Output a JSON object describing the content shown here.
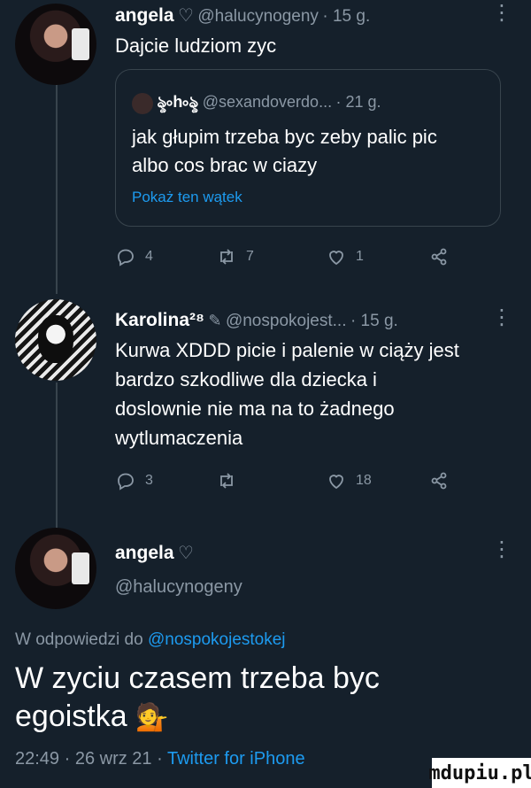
{
  "tweet1": {
    "name": "angela",
    "handle": "@halucynogeny",
    "time": "· 15 g.",
    "text": "Dajcie ludziom zyc",
    "quote": {
      "name": "ৡ৹h৹ৡ",
      "handle": "@sexandoverdo...",
      "time": "· 21 g.",
      "text_line1": "jak głupim trzeba byc zeby palic pic",
      "text_line2": "albo cos brac w ciazy",
      "show_thread": "Pokaż ten wątek"
    },
    "actions": {
      "replies": "4",
      "retweets": "7",
      "likes": "1"
    }
  },
  "tweet2": {
    "name": "Karolina²⁸",
    "handle": "@nospokojest...",
    "time": "· 15 g.",
    "lines": [
      "Kurwa XDDD picie i palenie w ciąży jest",
      "bardzo szkodliwe dla dziecka i",
      "doslownie nie ma na to żadnego",
      "wytlumaczenia"
    ],
    "actions": {
      "replies": "3",
      "retweets": "",
      "likes": "18"
    }
  },
  "main": {
    "name": "angela",
    "handle": "@halucynogeny",
    "reply_prefix": "W odpowiedzi do",
    "reply_handle": "@nospokojestokej",
    "text_line1": "W zyciu czasem trzeba byc",
    "text_line2": "egoistka",
    "meta": "22:49 · 26 wrz 21 · ",
    "client": "Twitter for iPhone"
  },
  "watermark": "mdupiu.pl",
  "colors": {
    "background": "#15202b",
    "muted": "#8b98a5",
    "link": "#1d9bf0",
    "border": "#38444d"
  }
}
